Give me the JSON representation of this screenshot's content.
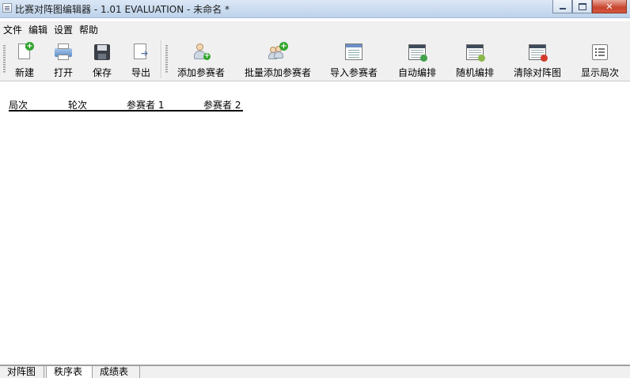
{
  "window": {
    "title": "比赛对阵图编辑器 - 1.01 EVALUATION - 未命名 *",
    "close_label": "✕"
  },
  "menu": {
    "items": [
      "文件",
      "编辑",
      "设置",
      "帮助"
    ]
  },
  "toolbar": {
    "new": "新建",
    "open": "打开",
    "save": "保存",
    "export": "导出",
    "add_participant": "添加参赛者",
    "batch_add_participants": "批量添加参赛者",
    "import_participants": "导入参赛者",
    "auto_arrange": "自动编排",
    "random_arrange": "随机编排",
    "clear_bracket": "清除对阵图",
    "show_rounds": "显示局次"
  },
  "schedule_table": {
    "columns": [
      "局次",
      "轮次",
      "参赛者 1",
      "参赛者 2"
    ]
  },
  "tabs": {
    "items": [
      "对阵图",
      "秩序表",
      "成绩表"
    ],
    "active": "秩序表"
  },
  "colors": {
    "title_bar": "#c9dbef",
    "toolbar_bg": "#f0f0f0",
    "close_button": "#c8432e",
    "plus_badge": "#2fa52a"
  }
}
